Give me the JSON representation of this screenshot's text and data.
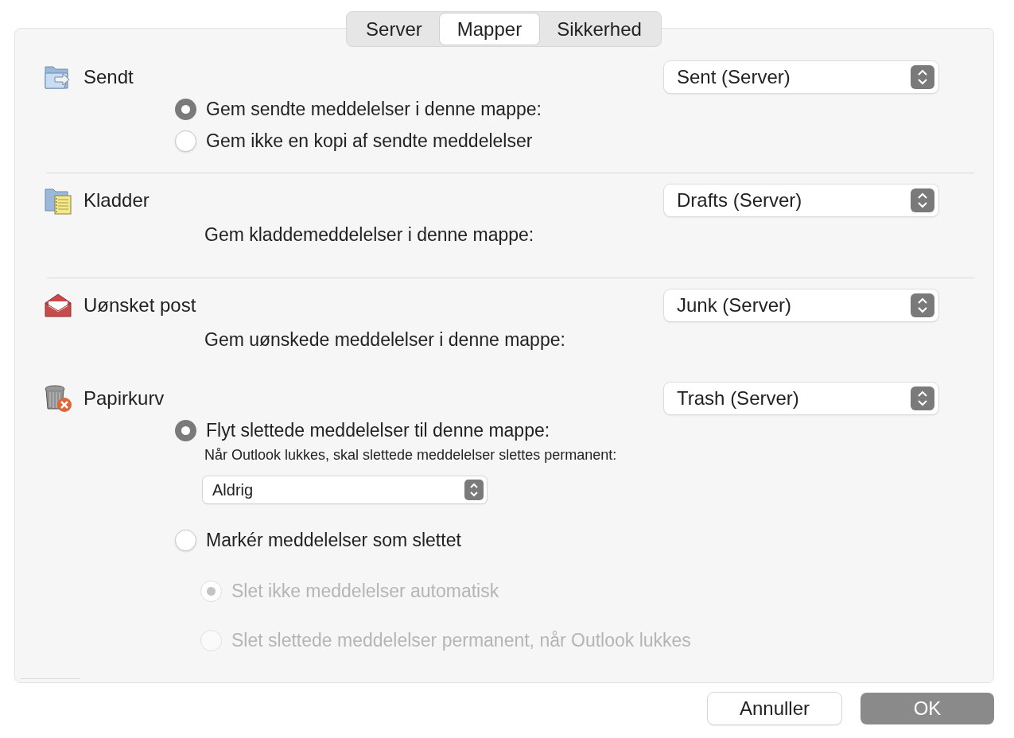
{
  "tabs": [
    {
      "label": "Server",
      "selected": false
    },
    {
      "label": "Mapper",
      "selected": true
    },
    {
      "label": "Sikkerhed",
      "selected": false
    }
  ],
  "sections": [
    {
      "title": "Sendt",
      "folder": "Sent (Server)",
      "divider": true,
      "items": [
        {
          "kind": "radio",
          "label": "Gem sendte meddelelser i denne mappe:",
          "selected": true,
          "disabled": false
        },
        {
          "kind": "radio",
          "label": "Gem ikke en kopi af sendte meddelelser",
          "selected": false,
          "disabled": false
        }
      ]
    },
    {
      "title": "Kladder",
      "folder": "Drafts (Server)",
      "divider": true,
      "items": [
        {
          "kind": "text",
          "label": "Gem kladdemeddelelser i denne mappe:"
        }
      ]
    },
    {
      "title": "Uønsket post",
      "folder": "Junk (Server)",
      "divider": false,
      "items": [
        {
          "kind": "text",
          "label": "Gem uønskede meddelelser i denne mappe:"
        }
      ]
    },
    {
      "title": "Papirkurv",
      "folder": "Trash (Server)",
      "divider": false,
      "items": [
        {
          "kind": "radio",
          "label": "Flyt slettede meddelelser til denne mappe:",
          "selected": true,
          "disabled": false
        },
        {
          "kind": "note",
          "label": "Når Outlook lukkes, skal slettede meddelelser slettes permanent:"
        },
        {
          "kind": "select",
          "label": "Aldrig"
        },
        {
          "kind": "radio",
          "label": "Markér meddelelser som slettet",
          "selected": false,
          "disabled": false,
          "children": [
            {
              "kind": "radio",
              "label": "Slet ikke meddelelser automatisk",
              "selected": true,
              "disabled": true
            },
            {
              "kind": "radio",
              "label": "Slet slettede meddelelser permanent, når Outlook lukkes",
              "selected": false,
              "disabled": true
            }
          ]
        }
      ]
    }
  ],
  "buttons": [
    {
      "label": "Annuller",
      "kind": "cancel"
    },
    {
      "label": "OK",
      "kind": "default"
    }
  ]
}
